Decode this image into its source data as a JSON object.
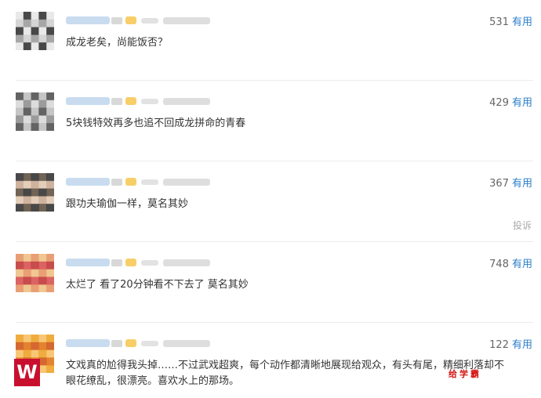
{
  "useful_label": "有用",
  "report_label": "投诉",
  "comments": [
    {
      "votes": "531",
      "text": "成龙老矣，尚能饭否？",
      "avatar_icon": "user-avatar-pixelated",
      "avatar_colors": [
        "#e8e8e8",
        "#9a9a9a",
        "#2a2a2a",
        "#d0d0d0"
      ]
    },
    {
      "votes": "429",
      "text": "5块钱特效再多也追不回成龙拼命的青春",
      "avatar_icon": "user-avatar-pixelated",
      "avatar_colors": [
        "#d8d8d8",
        "#4a4a4a",
        "#8c8c8c",
        "#bdbdbd"
      ]
    },
    {
      "votes": "367",
      "text": "跟功夫瑜伽一样，莫名其妙",
      "avatar_icon": "user-avatar-pixelated",
      "avatar_colors": [
        "#5a4a3a",
        "#c8a890",
        "#2a2a2a",
        "#e0c8b0"
      ]
    },
    {
      "votes": "748",
      "text": "太烂了 看了20分钟看不下去了 莫名其妙",
      "avatar_icon": "user-avatar-pixelated",
      "avatar_colors": [
        "#d84a4a",
        "#f0c080",
        "#c03030",
        "#e89060"
      ]
    },
    {
      "votes": "122",
      "text": "文戏真的尬得我头掉……不过武戏超爽，每个动作都清晰地展现给观众，有头有尾，精细利落却不眼花缭乱，很漂亮。喜欢水上的那场。",
      "avatar_icon": "user-avatar-pixelated",
      "avatar_colors": [
        "#f0a020",
        "#e07010",
        "#f8c060",
        "#d05010"
      ]
    }
  ],
  "watermark": {
    "logo": "W",
    "text": "给学霸"
  },
  "accent_colors": {
    "link": "#2b7ec9",
    "vip_badge": "#f5c242"
  }
}
